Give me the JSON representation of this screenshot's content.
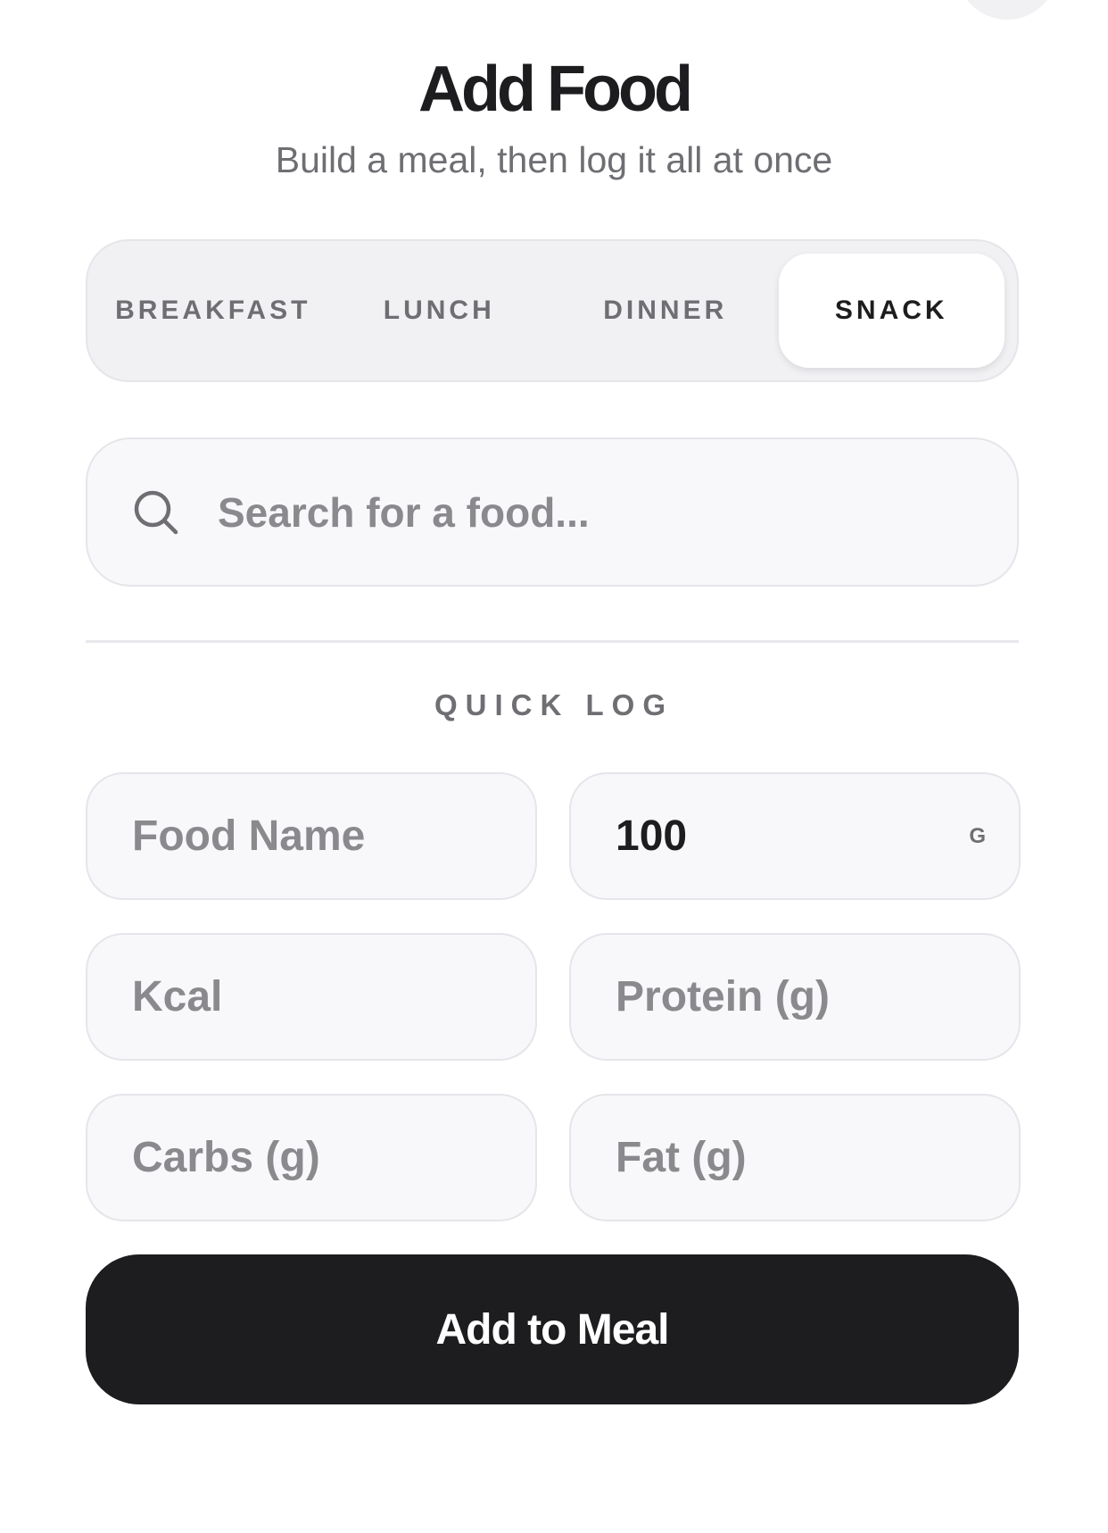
{
  "header": {
    "title": "Add Food",
    "subtitle": "Build a meal, then log it all at once"
  },
  "meal_tabs": {
    "items": [
      {
        "label": "BREAKFAST",
        "selected": false
      },
      {
        "label": "LUNCH",
        "selected": false
      },
      {
        "label": "DINNER",
        "selected": false
      },
      {
        "label": "SNACK",
        "selected": true
      }
    ]
  },
  "search": {
    "icon": "search-icon",
    "placeholder": "Search for a food...",
    "value": ""
  },
  "quick_log": {
    "label": "QUICK LOG",
    "food_name": {
      "placeholder": "Food Name",
      "value": ""
    },
    "amount": {
      "value": "100",
      "unit": "G"
    },
    "kcal": {
      "placeholder": "Kcal",
      "value": ""
    },
    "protein": {
      "placeholder": "Protein (g)",
      "value": ""
    },
    "carbs": {
      "placeholder": "Carbs (g)",
      "value": ""
    },
    "fat": {
      "placeholder": "Fat (g)",
      "value": ""
    }
  },
  "actions": {
    "add_label": "Add to Meal"
  },
  "colors": {
    "primary": "#1d1d1f",
    "muted_text": "#6e6e73",
    "placeholder": "#8a8a8e",
    "surface": "#f1f1f4",
    "field_bg": "#f8f8fa",
    "border": "#e5e5ea"
  }
}
